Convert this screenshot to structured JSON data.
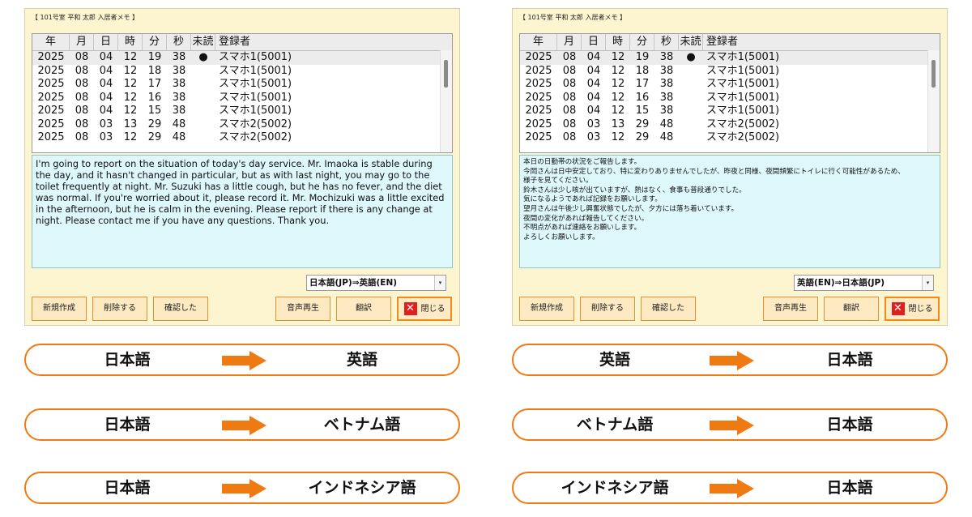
{
  "left_window": {
    "title": "【 101号室 平和 太郎 入居者メモ 】",
    "columns": [
      "年",
      "月",
      "日",
      "時",
      "分",
      "秒",
      "未読",
      "登録者"
    ],
    "rows": [
      [
        "2025",
        "08",
        "04",
        "12",
        "19",
        "38",
        "●",
        "スマホ1(5001)"
      ],
      [
        "2025",
        "08",
        "04",
        "12",
        "18",
        "38",
        "",
        "スマホ1(5001)"
      ],
      [
        "2025",
        "08",
        "04",
        "12",
        "17",
        "38",
        "",
        "スマホ1(5001)"
      ],
      [
        "2025",
        "08",
        "04",
        "12",
        "16",
        "38",
        "",
        "スマホ1(5001)"
      ],
      [
        "2025",
        "08",
        "04",
        "12",
        "15",
        "38",
        "",
        "スマホ1(5001)"
      ],
      [
        "2025",
        "08",
        "03",
        "13",
        "29",
        "48",
        "",
        "スマホ2(5002)"
      ],
      [
        "2025",
        "08",
        "03",
        "12",
        "29",
        "48",
        "",
        "スマホ2(5002)"
      ]
    ],
    "message": "I'm going to report on the situation of today's day service. Mr. Imaoka is stable during the day, and it hasn't changed in particular, but as with last night, you may go to the toilet frequently at night. Mr. Suzuki has a little cough, but he has no fever, and the diet was normal. If you're worried about it, please record it. Mr. Mochizuki was a little excited in the afternoon, but he is calm in the evening. Please report if there is any change at night. Please contact me if you have any questions. Thank you.",
    "language_select": "日本語(JP)⇒英語(EN)",
    "buttons": {
      "new": "新規作成",
      "delete": "削除する",
      "confirm": "確認した",
      "play": "音声再生",
      "translate": "翻訳",
      "close": "閉じる"
    }
  },
  "right_window": {
    "title": "【 101号室 平和 太郎 入居者メモ 】",
    "columns": [
      "年",
      "月",
      "日",
      "時",
      "分",
      "秒",
      "未読",
      "登録者"
    ],
    "rows": [
      [
        "2025",
        "08",
        "04",
        "12",
        "19",
        "38",
        "●",
        "スマホ1(5001)"
      ],
      [
        "2025",
        "08",
        "04",
        "12",
        "18",
        "38",
        "",
        "スマホ1(5001)"
      ],
      [
        "2025",
        "08",
        "04",
        "12",
        "17",
        "38",
        "",
        "スマホ1(5001)"
      ],
      [
        "2025",
        "08",
        "04",
        "12",
        "16",
        "38",
        "",
        "スマホ1(5001)"
      ],
      [
        "2025",
        "08",
        "04",
        "12",
        "15",
        "38",
        "",
        "スマホ1(5001)"
      ],
      [
        "2025",
        "08",
        "03",
        "13",
        "29",
        "48",
        "",
        "スマホ2(5002)"
      ],
      [
        "2025",
        "08",
        "03",
        "12",
        "29",
        "48",
        "",
        "スマホ2(5002)"
      ]
    ],
    "message_lines": [
      "本日の日勤帯の状況をご報告します。",
      "今岡さんは日中安定しており、特に変わりありませんでしたが、昨夜と同様、夜間頻繁にトイレに行く可能性があるため、",
      "様子を見てください。",
      "鈴木さんは少し咳が出ていますが、熱はなく、食事も普段通りでした。",
      "気になるようであれば記録をお願いします。",
      "望月さんは午後少し興奮状態でしたが、夕方には落ち着いています。",
      "夜間の変化があれば報告してください。",
      "不明点があれば連絡をお願いします。",
      "よろしくお願いします。"
    ],
    "language_select": "英語(EN)⇒日本語(JP)",
    "buttons": {
      "new": "新規作成",
      "delete": "削除する",
      "confirm": "確認した",
      "play": "音声再生",
      "translate": "翻訳",
      "close": "閉じる"
    }
  },
  "translation_pairs": {
    "left": [
      {
        "from": "日本語",
        "to": "英語"
      },
      {
        "from": "日本語",
        "to": "ベトナム語"
      },
      {
        "from": "日本語",
        "to": "インドネシア語"
      }
    ],
    "right": [
      {
        "from": "英語",
        "to": "日本語"
      },
      {
        "from": "ベトナム語",
        "to": "日本語"
      },
      {
        "from": "インドネシア語",
        "to": "日本語"
      }
    ]
  },
  "colors": {
    "accent_orange": "#f07a12",
    "message_bg": "#ddf7fb",
    "panel_bg": "#fdf4d0",
    "close_red": "#e02020"
  },
  "icons": {
    "close": "x-icon",
    "arrow": "arrow-right-icon",
    "scroll_thumb": "scrollbar-thumb"
  }
}
